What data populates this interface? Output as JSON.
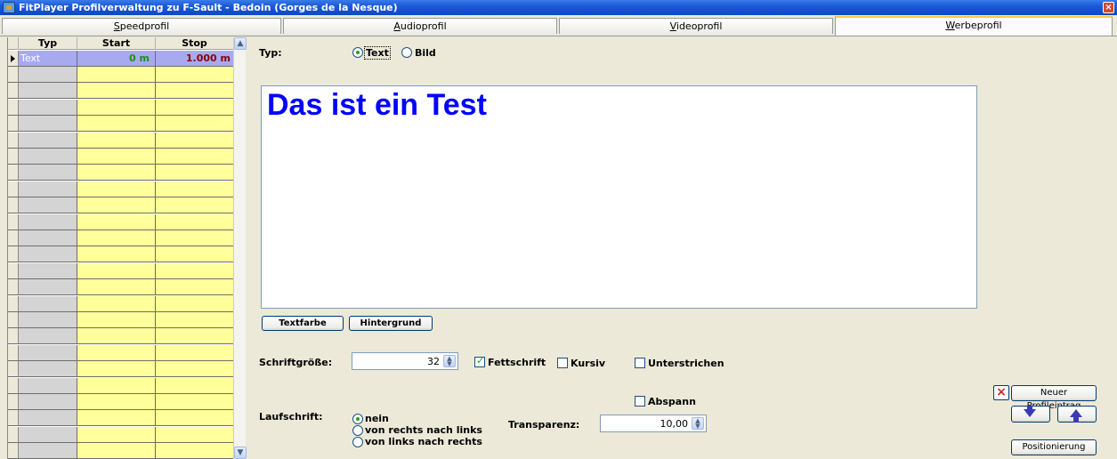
{
  "window": {
    "title": "FitPlayer Profilverwaltung zu F-Sault - Bedoin (Gorges de la Nesque)",
    "close_label": "×",
    "icon": "app-icon"
  },
  "tabs": [
    {
      "pre": "",
      "accel": "S",
      "rest": "peedprofil",
      "active": false
    },
    {
      "pre": "",
      "accel": "A",
      "rest": "udioprofil",
      "active": false
    },
    {
      "pre": "",
      "accel": "V",
      "rest": "ideoprofil",
      "active": false
    },
    {
      "pre": "",
      "accel": "W",
      "rest": "erbeprofil",
      "active": true
    }
  ],
  "grid": {
    "columns": [
      "Typ",
      "Start",
      "Stop"
    ],
    "selected_row": {
      "typ": "Text",
      "start": "0 m",
      "stop": "1.000 m"
    },
    "empty_rows": 24,
    "scroll_up": "▲",
    "scroll_down": "▼"
  },
  "form": {
    "typ_label": "Typ:",
    "typ_options": {
      "text": "Text",
      "bild": "Bild"
    },
    "typ_selected": "Text",
    "preview_text": "Das ist ein Test",
    "textfarbe_button": "Textfarbe",
    "hintergrund_button": "Hintergrund",
    "schriftgroesse_label": "Schriftgröße:",
    "schriftgroesse_value": "32",
    "fettschrift_label": "Fettschrift",
    "fettschrift_checked": true,
    "kursiv_label": "Kursiv",
    "kursiv_checked": false,
    "unterstrichen_label": "Unterstrichen",
    "unterstrichen_checked": false,
    "abspann_label": "Abspann",
    "abspann_checked": false,
    "laufschrift_label": "Laufschrift:",
    "laufschrift_options": [
      "nein",
      "von rechts nach links",
      "von links nach rechts"
    ],
    "laufschrift_selected": "nein",
    "transparenz_label": "Transparenz:",
    "transparenz_value": "10,00"
  },
  "actions": {
    "neuer_profileintrag": "Neuer Profileintrag",
    "positionierung": "Positionierung",
    "delete_icon": "×",
    "move_down_icon": "arrow-down-icon",
    "move_up_icon": "arrow-up-icon"
  },
  "colors": {
    "titlebar": "#0B48C4",
    "grid_yellow": "#FFFF9B",
    "grid_selected": "#A8AAF0",
    "preview_text": "#0000FF",
    "start_value": "#1a8f1a",
    "stop_value": "#8B0000"
  }
}
